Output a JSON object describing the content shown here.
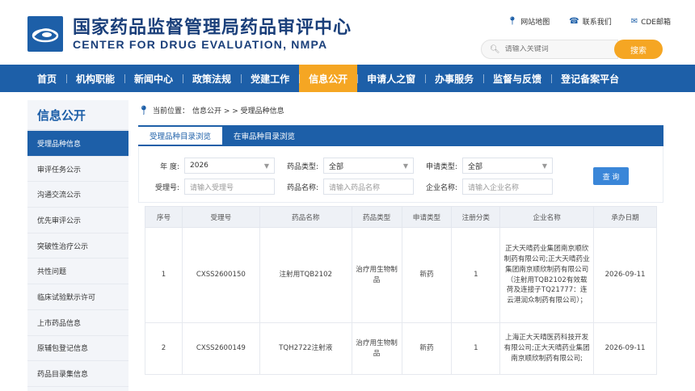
{
  "header": {
    "title_cn": "国家药品监督管理局药品审评中心",
    "title_en": "CENTER FOR DRUG EVALUATION, NMPA",
    "links": [
      {
        "icon": "location-pin-icon",
        "label": "网站地图"
      },
      {
        "icon": "phone-icon",
        "label": "联系我们"
      },
      {
        "icon": "mail-icon",
        "label": "CDE邮箱"
      }
    ],
    "search_placeholder": "请输入关键词",
    "search_button": "搜索"
  },
  "nav": {
    "items": [
      "首页",
      "机构职能",
      "新闻中心",
      "政策法规",
      "党建工作",
      "信息公开",
      "申请人之窗",
      "办事服务",
      "监督与反馈",
      "登记备案平台"
    ],
    "active_index": 5
  },
  "sidebar": {
    "title": "信息公开",
    "items": [
      "受理品种信息",
      "审评任务公示",
      "沟通交流公示",
      "优先审评公示",
      "突破性治疗公示",
      "共性问题",
      "临床试验默示许可",
      "上市药品信息",
      "原辅包登记信息",
      "药品目录集信息"
    ],
    "active_index": 0
  },
  "breadcrumb": {
    "prefix": "当前位置：",
    "path": "信息公开 > > 受理品种信息"
  },
  "tabs": [
    "受理品种目录浏览",
    "在审品种目录浏览"
  ],
  "filters": {
    "year_label": "年  度:",
    "year_value": "2026",
    "drug_type_label": "药品类型:",
    "drug_type_value": "全部",
    "apply_type_label": "申请类型:",
    "apply_type_value": "全部",
    "accept_no_label": "受理号:",
    "accept_no_placeholder": "请输入受理号",
    "drug_name_label": "药品名称:",
    "drug_name_placeholder": "请输入药品名称",
    "company_label": "企业名称:",
    "company_placeholder": "请输入企业名称",
    "query_button": "查 询"
  },
  "table": {
    "headers": [
      "序号",
      "受理号",
      "药品名称",
      "药品类型",
      "申请类型",
      "注册分类",
      "企业名称",
      "承办日期"
    ],
    "rows": [
      {
        "no": "1",
        "accept_no": "CXSS2600150",
        "drug_name": "注射用TQB2102",
        "drug_type": "治疗用生物制品",
        "apply_type": "新药",
        "reg_class": "1",
        "company": "正大天晴药业集团南京顺欣制药有限公司;正大天晴药业集团南京顺欣制药有限公司（注射用TQB2102有效载荷及连接子TQ21777：连云港润众制药有限公司）；",
        "date": "2026-09-11"
      },
      {
        "no": "2",
        "accept_no": "CXSS2600149",
        "drug_name": "TQH2722注射液",
        "drug_type": "治疗用生物制品",
        "apply_type": "新药",
        "reg_class": "1",
        "company": "上海正大天晴医药科技开发有限公司;正大天晴药业集团南京顺欣制药有限公司;",
        "date": "2026-09-11"
      }
    ]
  },
  "colors": {
    "brand_blue": "#1d5fa8",
    "accent_orange": "#f5a623"
  }
}
